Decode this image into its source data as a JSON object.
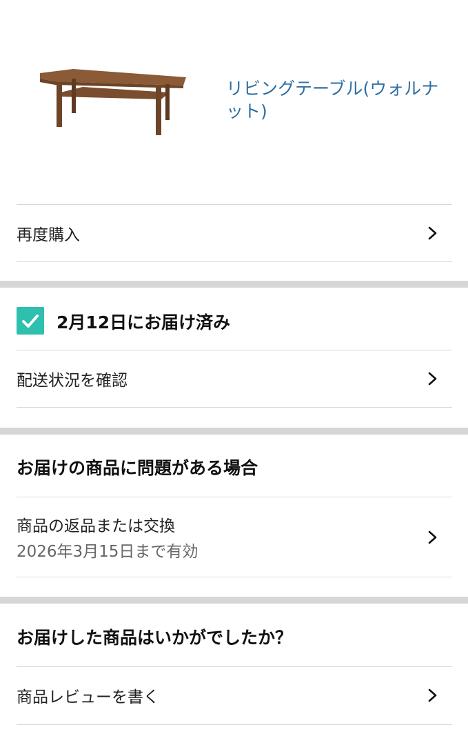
{
  "product": {
    "name": "リビングテーブル(ウォルナット)",
    "image": "coffee-table-image"
  },
  "actions": {
    "buy_again": "再度購入",
    "tracking": "配送状況を確認"
  },
  "delivery": {
    "status": "2月12日にお届け済み",
    "status_icon": "check-icon"
  },
  "problem": {
    "heading": "お届けの商品に問題がある場合",
    "return_label": "商品の返品または交換",
    "return_deadline": "2026年3月15日まで有効"
  },
  "feedback": {
    "heading": "お届けした商品はいかがでしたか？",
    "review_label": "商品レビューを書く"
  },
  "colors": {
    "link": "#2f6fa3",
    "check": "#2fbfae",
    "divider": "#d8d8d8",
    "band": "#d6d6d6"
  }
}
